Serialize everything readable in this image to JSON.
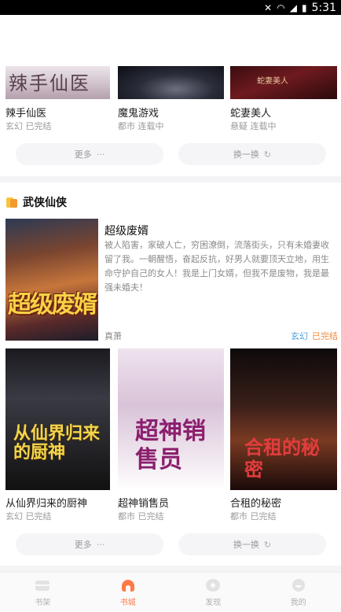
{
  "status_bar": {
    "time": "5:31",
    "icons": [
      "mute-icon",
      "wifi-icon",
      "signal-icon",
      "battery-icon"
    ]
  },
  "top_row": {
    "books": [
      {
        "title": "辣手仙医",
        "meta": "玄幻 已完结",
        "cover_text": "辣手仙医"
      },
      {
        "title": "魔鬼游戏",
        "meta": "都市 连载中",
        "cover_text": ""
      },
      {
        "title": "蛇妻美人",
        "meta": "悬疑 连载中",
        "cover_text": "蛇妻美人"
      }
    ],
    "more_label": "更多",
    "more_glyph": "···",
    "refresh_label": "换一换",
    "refresh_glyph": "↻"
  },
  "wuxia_section": {
    "title": "武侠仙侠",
    "featured": {
      "title": "超级废婿",
      "cover_text": "超级废婿",
      "description": "被人陷害，家破人亡，穷困潦倒，流落街头，只有未婚妻收留了我。一朝醒悟，奋起反抗，好男人就要顶天立地，用生命守护自己的女人！我是上门女婿，但我不是废物，我是最强未婚夫！",
      "author": "真萧",
      "genre": "玄幻",
      "status": "已完结"
    },
    "books": [
      {
        "title": "从仙界归来的厨神",
        "meta": "玄幻 已完结",
        "cover_text": "从仙界归来的厨神"
      },
      {
        "title": "超神销售员",
        "meta": "都市 已完结",
        "cover_text": "超神销售员"
      },
      {
        "title": "合租的秘密",
        "meta": "都市 已完结",
        "cover_text": "合租的秘密"
      }
    ],
    "more_label": "更多",
    "more_glyph": "···",
    "refresh_label": "换一换",
    "refresh_glyph": "↻"
  },
  "bottom_nav": {
    "items": [
      {
        "label": "书架",
        "icon": "bookshelf-icon",
        "active": false
      },
      {
        "label": "书城",
        "icon": "bookstore-icon",
        "active": true
      },
      {
        "label": "发现",
        "icon": "discover-icon",
        "active": false
      },
      {
        "label": "我的",
        "icon": "profile-icon",
        "active": false
      }
    ]
  },
  "colors": {
    "accent": "#ff7a45",
    "genre_tag": "#4aa3df",
    "status_tag": "#f08a3c"
  }
}
